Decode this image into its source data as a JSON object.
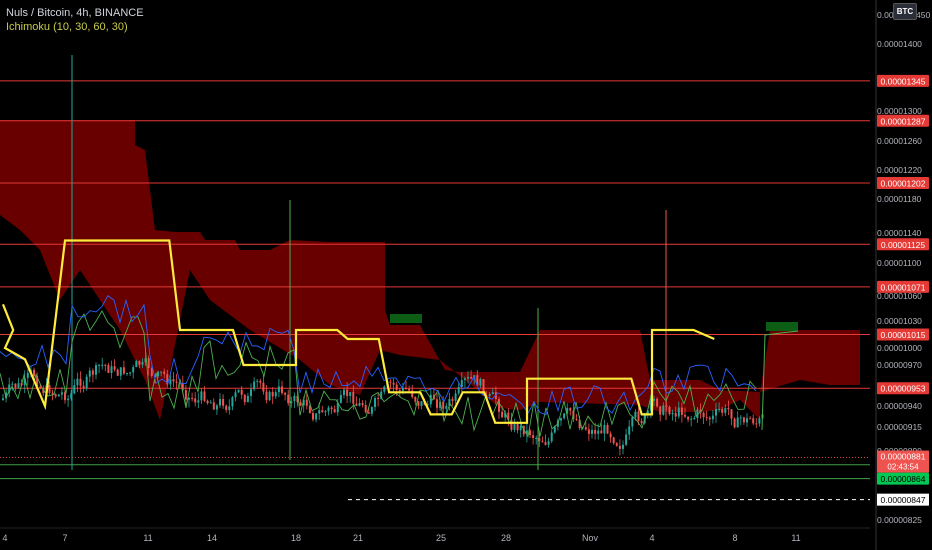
{
  "legend": {
    "title": "Nuls / Bitcoin, 4h, BINANCE",
    "indicator": "Ichimoku (10, 30, 60, 30)"
  },
  "badge": "BTC",
  "timer": "02:43:54",
  "colors": {
    "background": "#000000",
    "cloud": "#7a0000",
    "cloud_green": "#0b5e14",
    "kijun": "#ffeb3b",
    "tenkan": "#2962ff",
    "chikou": "#4caf50",
    "resistance": "#e53935",
    "support": "#43a047",
    "candle_up": "#26a69a",
    "candle_down": "#ef5350"
  },
  "chart_data": {
    "type": "candlestick",
    "title": "Nuls / Bitcoin, 4h, BINANCE",
    "indicator": "Ichimoku (10, 30, 60, 30)",
    "x_tick_labels": [
      "4",
      "7",
      "11",
      "14",
      "18",
      "21",
      "25",
      "28",
      "Nov",
      "4",
      "8",
      "11"
    ],
    "y_tick_labels": [
      "0.00001400",
      "0.00001300",
      "0.00001260",
      "0.00001220",
      "0.00001180",
      "0.00001140",
      "0.00001100",
      "0.00001060",
      "0.00001030",
      "0.00001000",
      "0.00000970",
      "0.00000940",
      "0.00000915",
      "0.00000890",
      "0.00000825"
    ],
    "y_top_partial_label": "0.0000",
    "y_top_partial_label_suffix": "450",
    "y_tick_values": [
      1.4e-05,
      1.3e-05,
      1.26e-05,
      1.22e-05,
      1.18e-05,
      1.14e-05,
      1.1e-05,
      1.06e-05,
      1.03e-05,
      1e-05,
      9.7e-06,
      9.4e-06,
      9.15e-06,
      8.9e-06,
      8.25e-06
    ],
    "horizontal_levels": [
      {
        "value": "0.00001345",
        "kind": "resistance"
      },
      {
        "value": "0.00001287",
        "kind": "resistance"
      },
      {
        "value": "0.00001202",
        "kind": "resistance"
      },
      {
        "value": "0.00001125",
        "kind": "resistance"
      },
      {
        "value": "0.00001071",
        "kind": "resistance"
      },
      {
        "value": "0.00001015",
        "kind": "resistance"
      },
      {
        "value": "0.00000953",
        "kind": "resistance"
      },
      {
        "value": "0.00000877",
        "kind": "support"
      },
      {
        "value": "0.00000864",
        "kind": "support"
      }
    ],
    "current_price": "0.00000881",
    "dashed_level": "0.00000847",
    "kijun_steps": [
      {
        "date": "Oct 3",
        "value": 1.05e-05
      },
      {
        "date": "Oct 3.5",
        "value": 1.02e-05
      },
      {
        "date": "Oct 4",
        "value": 1e-05
      },
      {
        "date": "Oct 5",
        "value": 9.8e-06
      },
      {
        "date": "Oct 6",
        "value": 9.4e-06
      },
      {
        "date": "Oct 7",
        "value": 1.13e-05
      },
      {
        "date": "Oct 12",
        "value": 1.13e-05
      },
      {
        "date": "Oct 12.5",
        "value": 1.02e-05
      },
      {
        "date": "Oct 15",
        "value": 1.02e-05
      },
      {
        "date": "Oct 15.5",
        "value": 9.7e-06
      },
      {
        "date": "Oct 18",
        "value": 9.7e-06
      },
      {
        "date": "Oct 18",
        "value": 1.02e-05
      },
      {
        "date": "Oct 20",
        "value": 1.02e-05
      },
      {
        "date": "Oct 20.5",
        "value": 1.01e-05
      },
      {
        "date": "Oct 22",
        "value": 1.01e-05
      },
      {
        "date": "Oct 22.5",
        "value": 9.5e-06
      },
      {
        "date": "Oct 24",
        "value": 9.5e-06
      },
      {
        "date": "Oct 24.5",
        "value": 9.3e-06
      },
      {
        "date": "Oct 25.5",
        "value": 9.3e-06
      },
      {
        "date": "Oct 26",
        "value": 9.5e-06
      },
      {
        "date": "Oct 27",
        "value": 9.5e-06
      },
      {
        "date": "Oct 27.5",
        "value": 9.2e-06
      },
      {
        "date": "Oct 29",
        "value": 9.2e-06
      },
      {
        "date": "Oct 29",
        "value": 9.6e-06
      },
      {
        "date": "Nov 3",
        "value": 9.6e-06
      },
      {
        "date": "Nov 3.5",
        "value": 9.3e-06
      },
      {
        "date": "Nov 4",
        "value": 9.3e-06
      },
      {
        "date": "Nov 4",
        "value": 1.02e-05
      },
      {
        "date": "Nov 6",
        "value": 1.02e-05
      },
      {
        "date": "Nov 7",
        "value": 1.01e-05
      }
    ]
  }
}
